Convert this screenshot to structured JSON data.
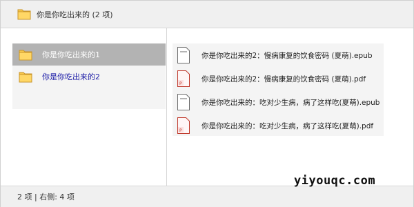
{
  "header": {
    "title": "你是你吃出来的 (2 项)",
    "icon": "folder-icon"
  },
  "left_pane": {
    "items": [
      {
        "label": "你是你吃出来的1",
        "icon": "folder-icon",
        "selected": true
      },
      {
        "label": "你是你吃出来的2",
        "icon": "folder-icon",
        "selected": false
      }
    ]
  },
  "right_pane": {
    "files": [
      {
        "label": "你是你吃出来的2：慢病康复的饮食密码 (夏萌).epub",
        "icon": "epub-file-icon"
      },
      {
        "label": "你是你吃出来的2：慢病康复的饮食密码 (夏萌).pdf",
        "icon": "pdf-file-icon"
      },
      {
        "label": "你是你吃出来的：吃对少生病，病了这样吃(夏萌).epub",
        "icon": "epub-file-icon"
      },
      {
        "label": "你是你吃出来的：吃对少生病，病了这样吃(夏萌).pdf",
        "icon": "pdf-file-icon"
      }
    ]
  },
  "status_bar": {
    "text": "2 项 | 右侧: 4 项"
  },
  "watermark": {
    "text": "yiyouqc.com"
  },
  "colors": {
    "folder_yellow": "#f6c64a",
    "selected_bg": "#b3b3b3",
    "link_blue": "#1a1aa6",
    "pdf_red": "#c0392b"
  }
}
